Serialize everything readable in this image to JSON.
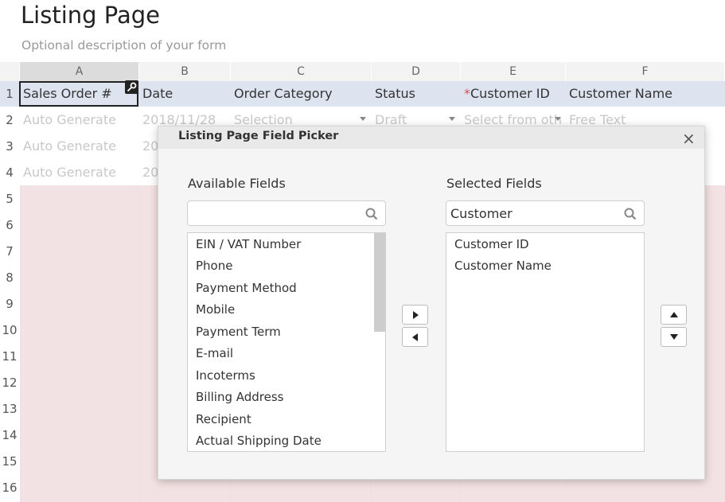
{
  "page": {
    "title": "Listing Page",
    "description": "Optional description of your form"
  },
  "sheet": {
    "column_letters": [
      "A",
      "B",
      "C",
      "D",
      "E",
      "F"
    ],
    "row_numbers": [
      "1",
      "2",
      "3",
      "4",
      "5",
      "6",
      "7",
      "8",
      "9",
      "10",
      "11",
      "12",
      "13",
      "14",
      "15",
      "16"
    ],
    "headers": {
      "a": "Sales Order #",
      "b": "Date",
      "c": "Order Category",
      "d": "Status",
      "e_required_mark": "*",
      "e": "Customer ID",
      "f": "Customer Name"
    },
    "row2": {
      "a": "Auto Generate",
      "b": "2018/11/28",
      "c": "Selection",
      "d": "Draft",
      "e": "Select from othe",
      "f": "Free Text"
    },
    "row3": {
      "a": "Auto Generate",
      "b": "20"
    },
    "row4": {
      "a": "Auto Generate",
      "b": "20"
    },
    "key_badge_icon": "key-icon",
    "required_color": "#d9534f",
    "header_row_color": "#dde3ef",
    "empty_rows_color": "#f3e2e3"
  },
  "modal": {
    "title": "Listing Page Field Picker",
    "close_label": "×",
    "available": {
      "label": "Available Fields",
      "search_value": "",
      "items": [
        "EIN / VAT Number",
        "Phone",
        "Payment Method",
        "Mobile",
        "Payment Term",
        "E-mail",
        "Incoterms",
        "Billing Address",
        "Recipient",
        "Actual Shipping Date"
      ]
    },
    "selected": {
      "label": "Selected Fields",
      "search_value": "Customer",
      "items": [
        "Customer ID",
        "Customer Name"
      ]
    },
    "buttons": {
      "move_right_icon": "caret-right-icon",
      "move_left_icon": "caret-left-icon",
      "move_up_icon": "caret-up-icon",
      "move_down_icon": "caret-down-icon"
    }
  }
}
